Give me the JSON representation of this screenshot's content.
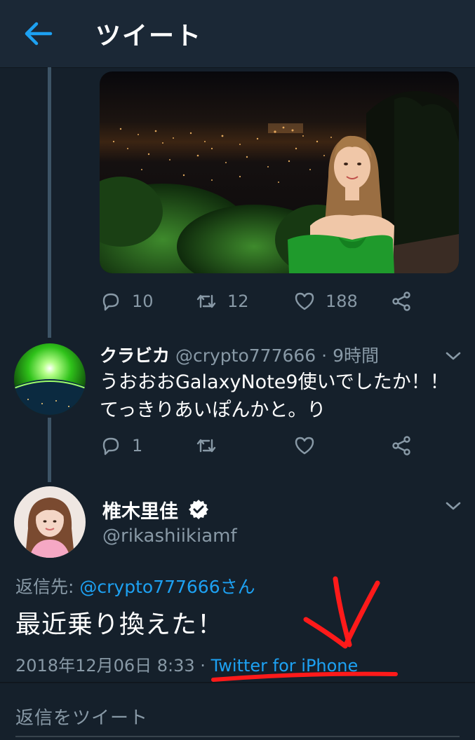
{
  "header": {
    "title": "ツイート"
  },
  "tweet1": {
    "actions": {
      "replies": "10",
      "retweets": "12",
      "likes": "188"
    }
  },
  "tweet2": {
    "name": "クラビカ",
    "handle": "@crypto777666",
    "time": "9時間",
    "text_line1": "うおおおGalaxyNote9使いでしたか！！",
    "text_line2": "てっきりあいぽんかと。り",
    "actions": {
      "replies": "1"
    }
  },
  "main_tweet": {
    "name": "椎木里佳",
    "handle": "@rikashiikiamf",
    "reply_prefix": "返信先: ",
    "reply_to": "@crypto777666さん",
    "text": "最近乗り換えた！",
    "date": "2018年12月06日 8:33 · ",
    "source": "Twitter for iPhone"
  },
  "reply_box": {
    "placeholder": "返信をツイート"
  },
  "colors": {
    "background": "#15202b",
    "header": "#1b2836",
    "accent": "#1da1f2",
    "secondary_text": "#8899a6",
    "annotation": "#ff1a1a"
  },
  "icons": [
    "back-arrow-icon",
    "reply-icon",
    "retweet-icon",
    "like-icon",
    "share-icon",
    "chevron-down-icon",
    "verified-badge-icon"
  ]
}
